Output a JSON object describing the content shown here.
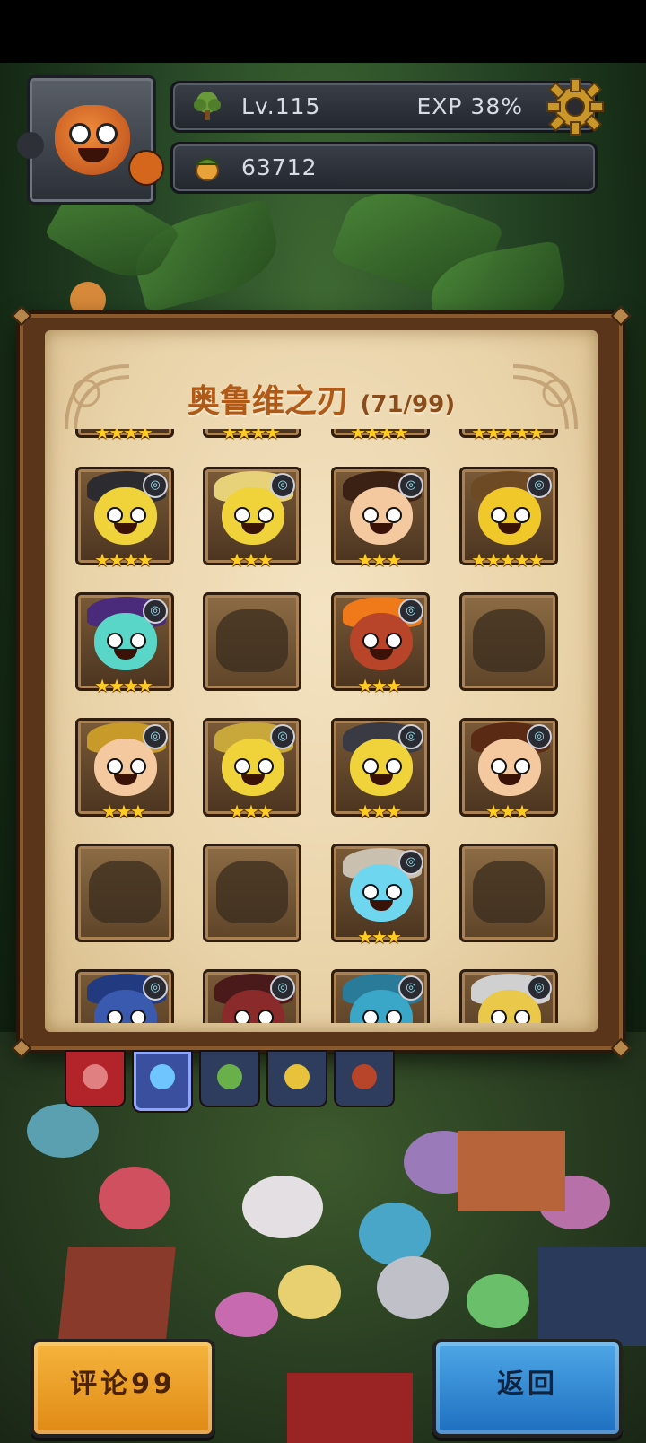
{
  "header": {
    "level": "Lv.115",
    "exp": "EXP 38%",
    "currency": "63712"
  },
  "panel": {
    "title": "奥鲁维之刃",
    "count": "(71/99)",
    "rows": [
      [
        {
          "stars": "★★★★",
          "state": "partial"
        },
        {
          "stars": "★★★★",
          "state": "partial"
        },
        {
          "stars": "★★★★",
          "state": "partial"
        },
        {
          "stars": "★★★★★",
          "state": "partial"
        }
      ],
      [
        {
          "stars": "★★★★",
          "state": "owned",
          "color": "#f0d23a",
          "hair": "#2b2b30",
          "badge": "◎"
        },
        {
          "stars": "★★★",
          "state": "owned",
          "color": "#f0d23a",
          "hair": "#e7d27a",
          "badge": "◎"
        },
        {
          "stars": "★★★",
          "state": "owned",
          "color": "#f5c9a0",
          "hair": "#3b2114",
          "badge": "◎"
        },
        {
          "stars": "★★★★★",
          "state": "owned",
          "color": "#f0c82a",
          "hair": "#6d4a24",
          "badge": "◎"
        }
      ],
      [
        {
          "stars": "★★★★",
          "state": "owned",
          "color": "#5ad6c8",
          "hair": "#4a2a7a",
          "badge": "◎"
        },
        {
          "stars": "",
          "state": "locked"
        },
        {
          "stars": "★★★",
          "state": "owned",
          "color": "#b8442a",
          "hair": "#f07a1a",
          "badge": "◎"
        },
        {
          "stars": "",
          "state": "locked"
        }
      ],
      [
        {
          "stars": "★★★",
          "state": "owned",
          "color": "#f5c9a0",
          "hair": "#c79a2a",
          "badge": "◎"
        },
        {
          "stars": "★★★",
          "state": "owned",
          "color": "#f0d23a",
          "hair": "#c8a83a",
          "badge": "◎"
        },
        {
          "stars": "★★★",
          "state": "owned",
          "color": "#f0d23a",
          "hair": "#3a3a44",
          "badge": "◎"
        },
        {
          "stars": "★★★",
          "state": "owned",
          "color": "#f5c9a0",
          "hair": "#5a2a14",
          "badge": "◎"
        }
      ],
      [
        {
          "stars": "",
          "state": "locked"
        },
        {
          "stars": "",
          "state": "locked"
        },
        {
          "stars": "★★★",
          "state": "owned",
          "color": "#6fd6f0",
          "hair": "#c9c0b0",
          "badge": "◎"
        },
        {
          "stars": "",
          "state": "locked"
        }
      ],
      [
        {
          "stars": "",
          "state": "owned",
          "color": "#3a5ab0",
          "hair": "#223a80",
          "badge": "◎"
        },
        {
          "stars": "",
          "state": "owned",
          "color": "#8a2a2a",
          "hair": "#4a1a1a",
          "badge": "◎"
        },
        {
          "stars": "",
          "state": "owned",
          "color": "#3aa6c8",
          "hair": "#2a7a9a",
          "badge": "◎"
        },
        {
          "stars": "",
          "state": "owned",
          "color": "#e9c84a",
          "hair": "#d0d0d0",
          "badge": "◎"
        }
      ]
    ]
  },
  "tabs": [
    {
      "name": "tab-red",
      "color": "#b3242a",
      "icon": "#e08080"
    },
    {
      "name": "tab-blue",
      "color": "#3a4f9e",
      "icon": "#6fc6ff",
      "active": true
    },
    {
      "name": "tab-green",
      "color": "#2e3d5e",
      "icon": "#6ab04a"
    },
    {
      "name": "tab-yellow",
      "color": "#2e3d5e",
      "icon": "#e8c23a"
    },
    {
      "name": "tab-darkred",
      "color": "#2e3d5e",
      "icon": "#b8442a"
    }
  ],
  "buttons": {
    "comment": "评论99",
    "back": "返回"
  },
  "colors": {
    "title": "#b15a18",
    "star": "#ffcc22",
    "comment_btn": "#f0a02a",
    "back_btn": "#3a8ad6"
  }
}
